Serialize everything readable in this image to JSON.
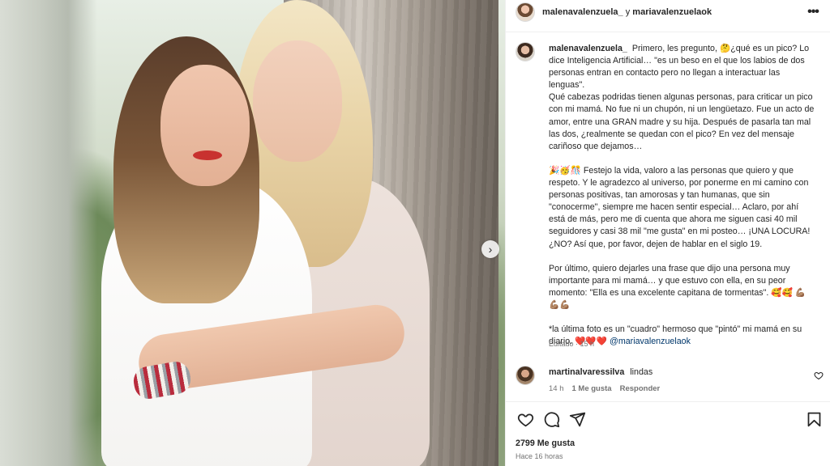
{
  "header": {
    "user1": "malenavalenzuela_",
    "connector": "y",
    "user2": "mariavalenzuelaok",
    "more_icon": "more-horizontal-icon"
  },
  "caption": {
    "username": "malenavalenzuela_",
    "p1_text": "Primero, les pregunto, 🤔¿qué es un pico? Lo dice Inteligencia Artificial… \"es un beso en el que los labios de dos personas entran en contacto pero no llegan a interactuar las lenguas\".",
    "p1_line2": "Qué cabezas podridas tienen algunas personas, para criticar un pico con mi mamá. No fue ni un chupón, ni un lengüetazo. Fue un acto de amor, entre una GRAN madre y su hija. Después de pasarla tan mal las dos, ¿realmente se quedan con el pico? En vez del mensaje cariñoso que dejamos…",
    "p2": "🎉🥳🎊 Festejo la vida, valoro a las personas que quiero y que respeto. Y le agradezco al universo, por ponerme en mi camino con personas positivas, tan amorosas y tan humanas, que sin \"conocerme\", siempre me hacen sentir especial… Aclaro, por ahí está de más, pero me di cuenta que ahora me siguen casi 40 mil seguidores y casi 38 mil \"me gusta\" en mi posteo… ¡UNA LOCURA! ¿NO? Así que, por favor, dejen de hablar en el siglo 19.",
    "p3": "Por último, quiero dejarles una frase que dijo una persona muy importante para mi mamá… y que estuvo con ella, en su peor momento: \"Ella es una excelente capitana de tormentas\". 🥰🥰 💪🏽💪🏽💪🏽",
    "p4_text": "*la última foto es un \"cuadro\" hermoso que \"pintó\" mi mamá en su diario. ❤️❤️❤️",
    "p4_mention": "@mariavalenzuelaok",
    "edited": "Editado · 15 h"
  },
  "comment": {
    "username": "martinalvaressilva",
    "text": "lindas",
    "time": "14 h",
    "likes": "1 Me gusta",
    "reply": "Responder",
    "like_icon": "heart-icon"
  },
  "actions": {
    "like_icon": "heart-icon",
    "comment_icon": "comment-icon",
    "share_icon": "paper-plane-icon",
    "save_icon": "bookmark-icon"
  },
  "likes_count": "2799 Me gusta",
  "posted_time": "Hace 16 horas",
  "photo": {
    "next_icon": "chevron-right-icon"
  }
}
